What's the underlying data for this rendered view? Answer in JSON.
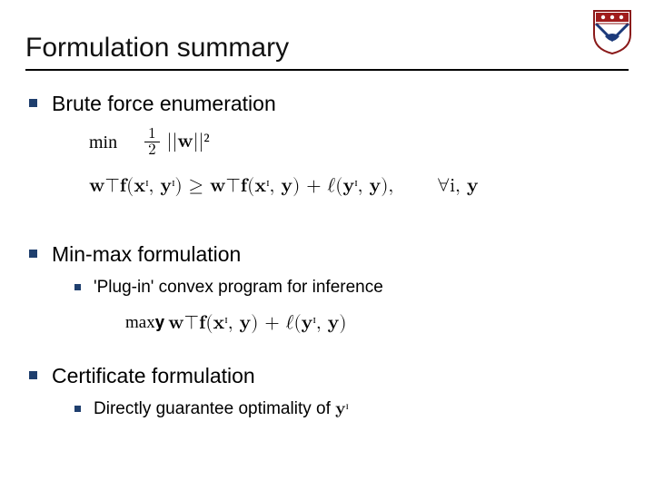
{
  "title": "Formulation summary",
  "bullets": {
    "brute": "Brute force enumeration",
    "minmax": "Min-max formulation",
    "plugin": "'Plug-in' convex program for inference",
    "cert": "Certificate formulation",
    "direct": "Directly guarantee optimality of "
  },
  "math": {
    "min_label": "min",
    "obj_frac_num": "1",
    "obj_frac_den": "2",
    "obj_rest": "||𝐰||²",
    "constraint_lhs": "𝐰⊤𝐟(𝐱ᶦ, 𝐲ᶦ) ≥ 𝐰⊤𝐟(𝐱ᶦ, 𝐲) + ℓ(𝐲ᶦ, 𝐲),",
    "constraint_rhs": "∀i, 𝐲",
    "max_label": "max𝐲",
    "max_expr": " 𝐰⊤𝐟(𝐱ᶦ, 𝐲) + ℓ(𝐲ᶦ, 𝐲)",
    "yi": "𝐲ᶦ"
  }
}
